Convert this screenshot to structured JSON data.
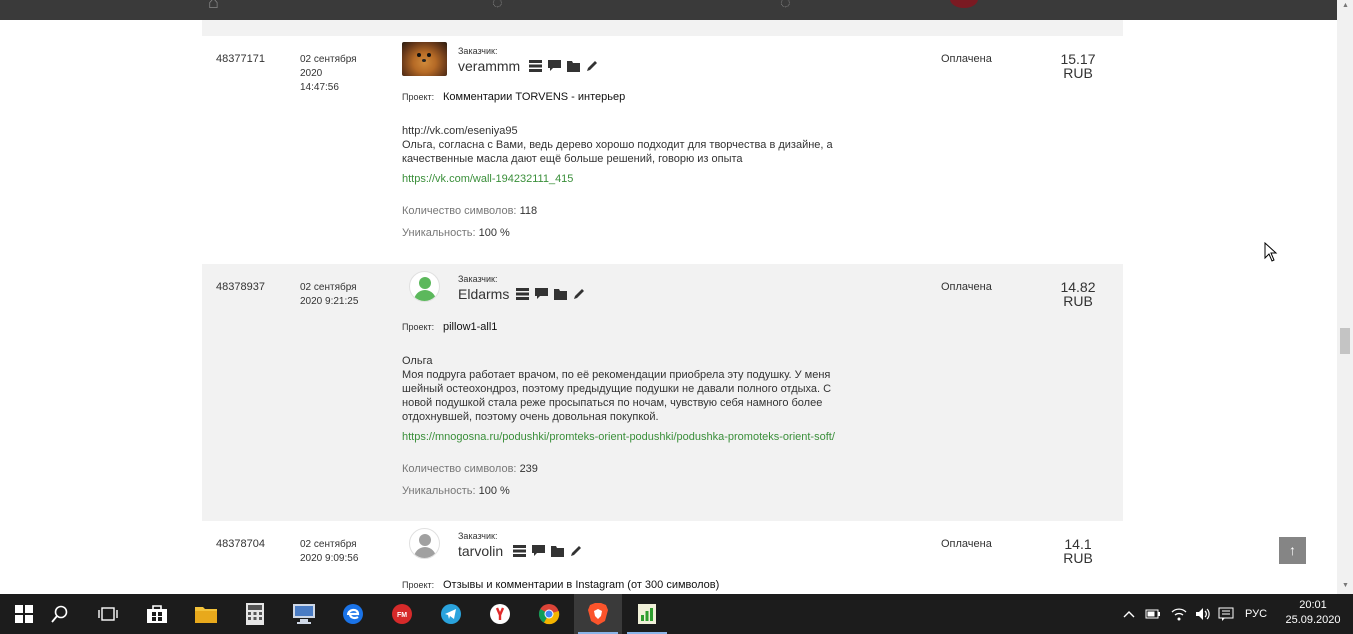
{
  "orders": [
    {
      "id": "48377171",
      "date": "02 сентября 2020",
      "time": "14:47:56",
      "customer_label": "Заказчик:",
      "customer": "verammm",
      "project_label": "Проект:",
      "project": "Комментарии TORVENS - интерьер",
      "text_lines": [
        "http://vk.com/eseniya95",
        "Ольга, согласна с Вами, ведь дерево хорошо подходит для творчества в дизайне, а",
        "качественные масла дают ещё больше решений, говорю из опыта"
      ],
      "link": "https://vk.com/wall-194232111_415",
      "chars_label": "Количество символов:",
      "chars": "118",
      "uniq_label": "Уникальность:",
      "uniq": "100 %",
      "status": "Оплачена",
      "price": "15.17",
      "currency": "RUB"
    },
    {
      "id": "48378937",
      "date": "02 сентября",
      "time": "2020 9:21:25",
      "customer_label": "Заказчик:",
      "customer": "Eldarms",
      "project_label": "Проект:",
      "project": "pillow1-all1",
      "text_lines": [
        "Ольга",
        "Моя подруга работает врачом, по её рекомендации приобрела эту подушку. У меня",
        "шейный остеохондроз, поэтому предыдущие подушки не давали полного отдыха. С",
        "новой подушкой стала реже просыпаться по ночам, чувствую себя намного более",
        "отдохнувшей, поэтому очень довольная покупкой."
      ],
      "link": "https://mnogosna.ru/podushki/promteks-orient-podushki/podushka-promoteks-orient-soft/",
      "chars_label": "Количество символов:",
      "chars": "239",
      "uniq_label": "Уникальность:",
      "uniq": "100 %",
      "status": "Оплачена",
      "price": "14.82",
      "currency": "RUB"
    },
    {
      "id": "48378704",
      "date": "02 сентября",
      "time": "2020 9:09:56",
      "customer_label": "Заказчик:",
      "customer": "tarvolin",
      "project_label": "Проект:",
      "project": "Отзывы и комментарии в Instagram (от 300 символов)",
      "status": "Оплачена",
      "price": "14.1",
      "currency": "RUB"
    }
  ],
  "scroll_top_glyph": "↑",
  "taskbar": {
    "tray_lang": "РУС",
    "clock_time": "20:01",
    "clock_date": "25.09.2020"
  },
  "colors": {
    "link": "#3a8f3a",
    "row_alt": "#f2f2f2",
    "taskbar": "#1c1c1c",
    "avatar_default": "#5cb85c"
  }
}
